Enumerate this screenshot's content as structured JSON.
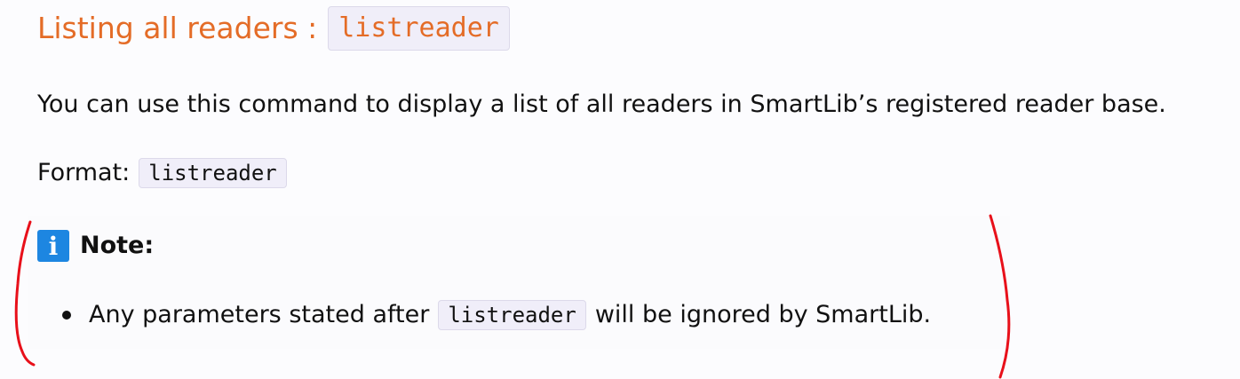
{
  "section": {
    "title": "Listing all readers :",
    "command": "listreader"
  },
  "description": "You can use this command to display a list of all readers in SmartLib’s registered reader base.",
  "format": {
    "label": "Format:",
    "command": "listreader"
  },
  "note": {
    "icon": "info-icon",
    "icon_glyph": "i",
    "title": "Note:",
    "bullets": [
      {
        "before": "Any parameters stated after",
        "code": "listreader",
        "after": "will be ignored by SmartLib."
      }
    ]
  },
  "colors": {
    "heading": "#e46c27",
    "code_background": "#f0eef9",
    "info_icon": "#1d86e1",
    "annotation_marks": "#e8101a"
  }
}
